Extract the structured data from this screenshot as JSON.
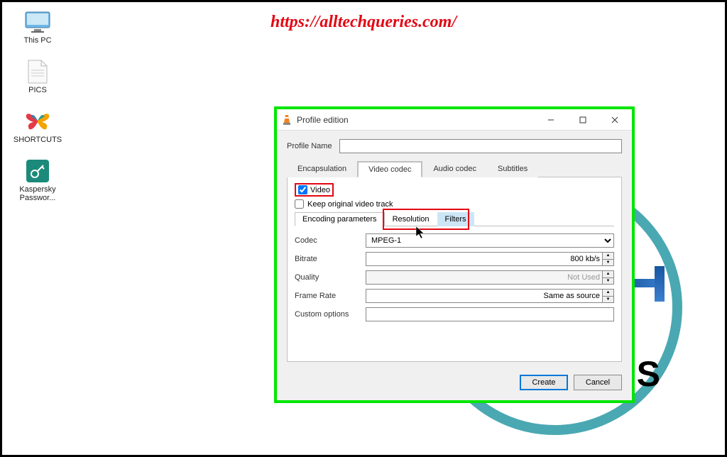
{
  "watermark": "https://alltechqueries.com/",
  "desktop_icons": [
    {
      "name": "this-pc",
      "label": "This PC"
    },
    {
      "name": "pics",
      "label": "PICS"
    },
    {
      "name": "shortcuts",
      "label": "SHORTCUTS"
    },
    {
      "name": "kaspersky",
      "label": "Kaspersky Passwor..."
    }
  ],
  "dialog": {
    "title": "Profile edition",
    "profile_name_label": "Profile Name",
    "profile_name_value": "",
    "tabs": {
      "encapsulation": "Encapsulation",
      "video_codec": "Video codec",
      "audio_codec": "Audio codec",
      "subtitles": "Subtitles"
    },
    "video_checkbox": "Video",
    "video_checked": true,
    "keep_original_label": "Keep original video track",
    "keep_original_checked": false,
    "subtabs": {
      "encoding": "Encoding parameters",
      "resolution": "Resolution",
      "filters": "Filters"
    },
    "form": {
      "codec_label": "Codec",
      "codec_value": "MPEG-1",
      "bitrate_label": "Bitrate",
      "bitrate_value": "800 kb/s",
      "quality_label": "Quality",
      "quality_value": "Not Used",
      "framerate_label": "Frame Rate",
      "framerate_value": "Same as source",
      "custom_label": "Custom options",
      "custom_value": ""
    },
    "buttons": {
      "create": "Create",
      "cancel": "Cancel"
    }
  }
}
